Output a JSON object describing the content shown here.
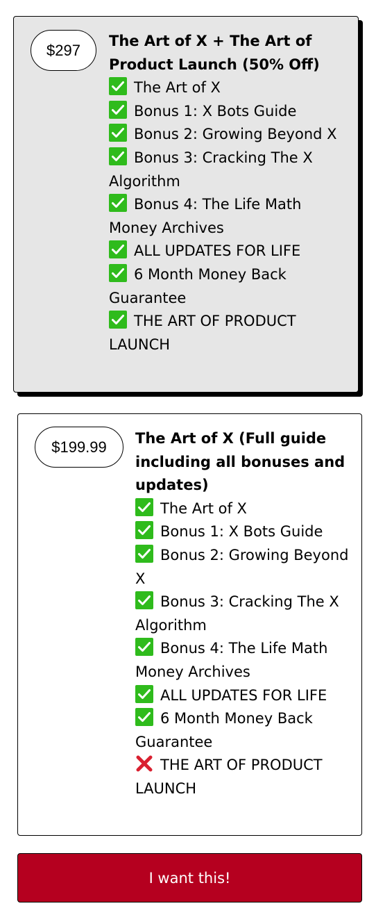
{
  "offers": [
    {
      "price": "$297",
      "title": "The Art of X + The Art of Product Launch (50% Off)",
      "features": [
        {
          "text": "The Art of X",
          "included": true,
          "icon": "check-icon"
        },
        {
          "text": "Bonus 1: X Bots Guide",
          "included": true,
          "icon": "check-icon"
        },
        {
          "text": "Bonus 2: Growing Beyond X",
          "included": true,
          "icon": "check-icon"
        },
        {
          "text": "Bonus 3: Cracking The X Algorithm",
          "included": true,
          "icon": "check-icon"
        },
        {
          "text": "Bonus 4: The Life Math Money Archives",
          "included": true,
          "icon": "check-icon"
        },
        {
          "text": "ALL UPDATES FOR LIFE",
          "included": true,
          "icon": "check-icon"
        },
        {
          "text": "6 Month Money Back Guarantee",
          "included": true,
          "icon": "check-icon"
        },
        {
          "text": "THE ART OF PRODUCT LAUNCH",
          "included": true,
          "icon": "check-icon"
        }
      ]
    },
    {
      "price": "$199.99",
      "title": "The Art of X (Full guide including all bonuses and updates)",
      "features": [
        {
          "text": "The Art of X",
          "included": true,
          "icon": "check-icon"
        },
        {
          "text": "Bonus 1: X Bots Guide",
          "included": true,
          "icon": "check-icon"
        },
        {
          "text": "Bonus 2: Growing Beyond X",
          "included": true,
          "icon": "check-icon"
        },
        {
          "text": "Bonus 3: Cracking The X Algorithm",
          "included": true,
          "icon": "check-icon"
        },
        {
          "text": "Bonus 4: The Life Math Money Archives",
          "included": true,
          "icon": "check-icon"
        },
        {
          "text": "ALL UPDATES FOR LIFE",
          "included": true,
          "icon": "check-icon"
        },
        {
          "text": "6 Month Money Back Guarantee",
          "included": true,
          "icon": "check-icon"
        },
        {
          "text": "THE ART OF PRODUCT LAUNCH",
          "included": false,
          "icon": "cross-icon"
        }
      ]
    }
  ],
  "cta": {
    "label": "I want this!"
  },
  "colors": {
    "selected_card_bg": "#e6e6e6",
    "card_bg": "#ffffff",
    "check": "#2fbb1c",
    "cross": "#d92030",
    "cta_bg": "#b5001f",
    "cta_text": "#ffffff"
  }
}
